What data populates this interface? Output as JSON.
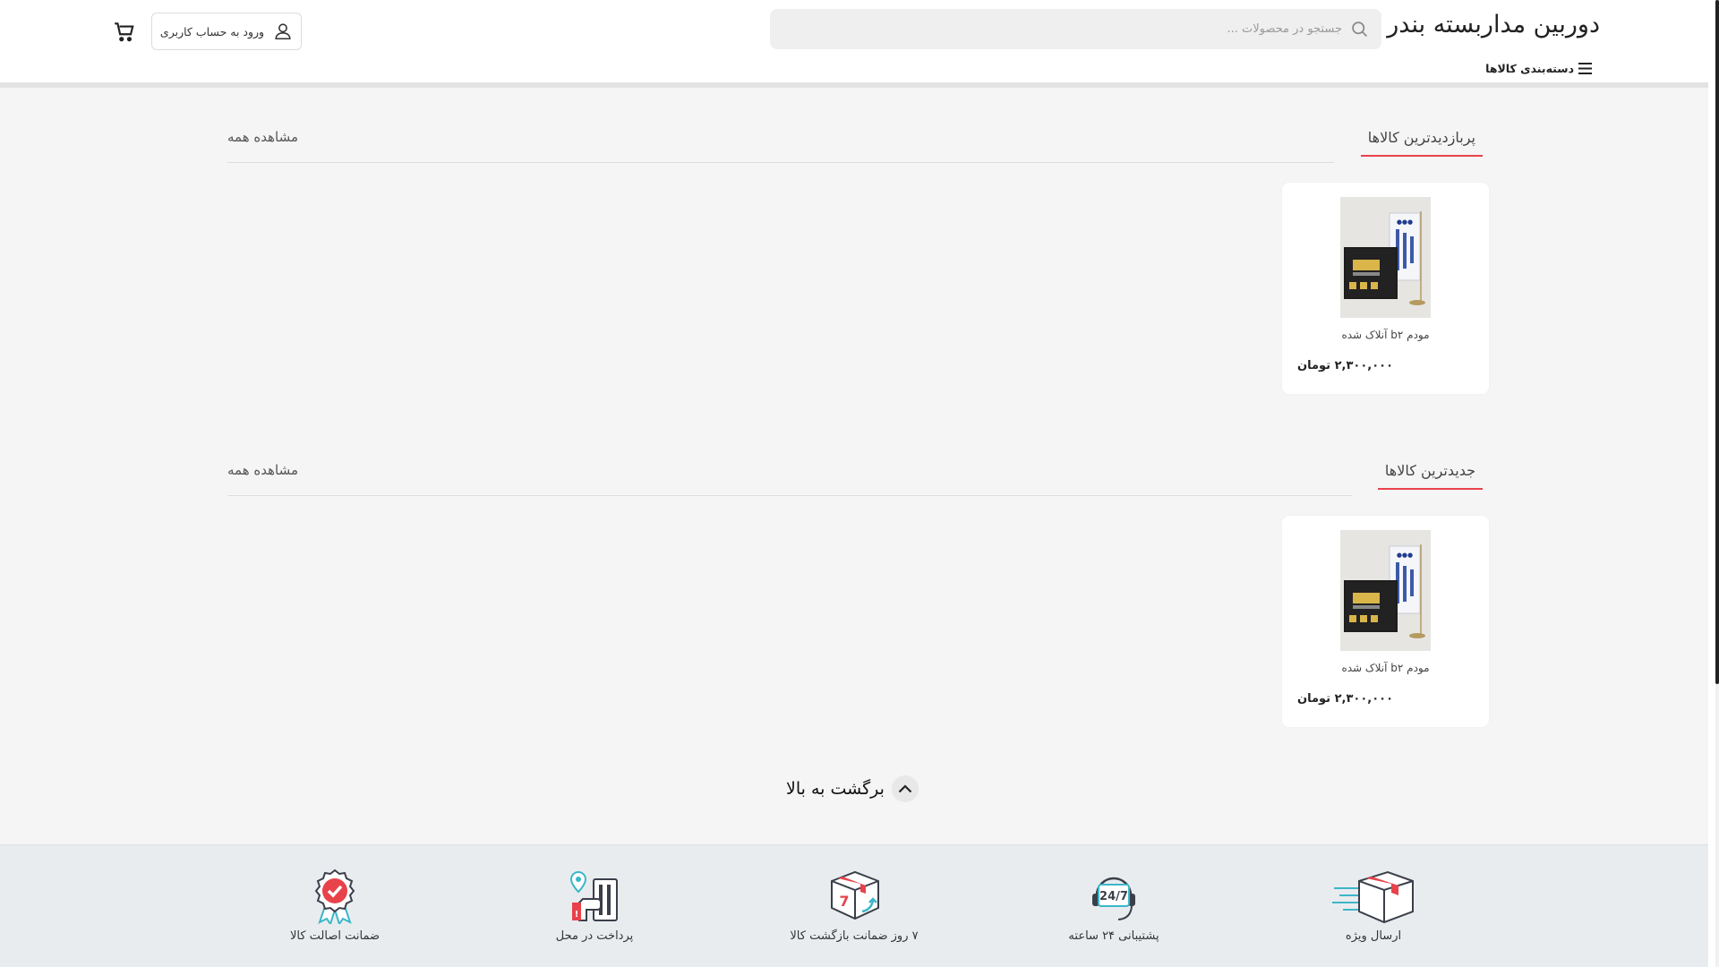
{
  "header": {
    "site_title": "دوربین مداربسته بندر",
    "search_placeholder": "جستجو در محصولات ...",
    "login_label": "ورود به حساب کاربری",
    "categories_label": "دسته‌بندی کالاها"
  },
  "sections": [
    {
      "title": "پربازدیدترین کالاها",
      "see_all": "مشاهده همه",
      "products": [
        {
          "name": "مودم b۲ آنلاک شده",
          "price": "۲,۳۰۰,۰۰۰ تومان"
        }
      ]
    },
    {
      "title": "جدیدترین کالاها",
      "see_all": "مشاهده همه",
      "products": [
        {
          "name": "مودم b۲ آنلاک شده",
          "price": "۲,۳۰۰,۰۰۰ تومان"
        }
      ]
    }
  ],
  "back_to_top": "برگشت به بالا",
  "features": [
    {
      "icon": "fast-delivery-box-icon",
      "label": "ارسال ویژه"
    },
    {
      "icon": "support-24-7-icon",
      "label": "پشتیبانی ۲۴ ساعته"
    },
    {
      "icon": "return-box-icon",
      "label": "۷ روز ضمانت بازگشت کالا"
    },
    {
      "icon": "pay-on-delivery-icon",
      "label": "پرداخت در محل"
    },
    {
      "icon": "authenticity-badge-icon",
      "label": "ضمانت اصالت کالا"
    }
  ],
  "colors": {
    "accent": "#e8424b",
    "footer_bg": "#e9ecef",
    "icon_teal": "#3bb6c9",
    "icon_dark": "#3a3f4a"
  }
}
